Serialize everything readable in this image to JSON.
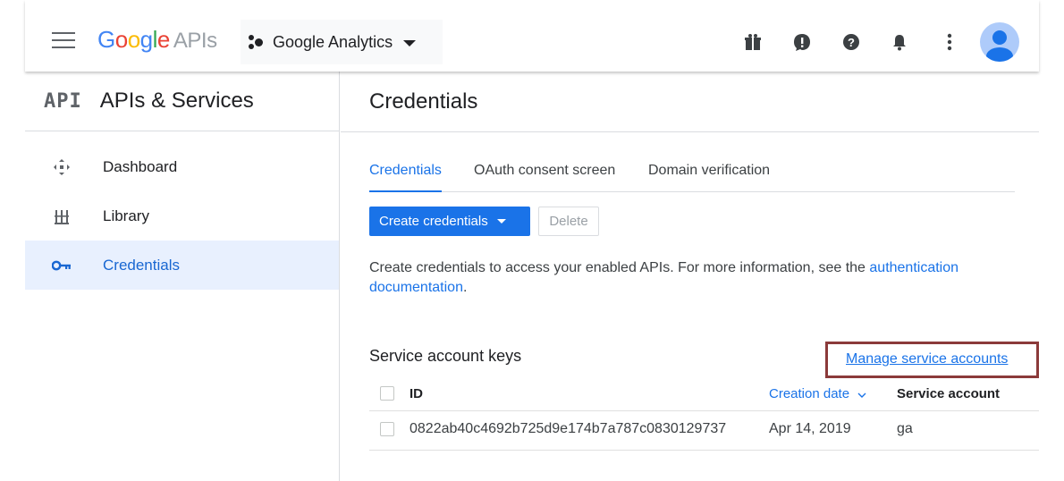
{
  "topbar": {
    "logo_letters": [
      "G",
      "o",
      "o",
      "g",
      "l",
      "e"
    ],
    "logo_suffix": "APIs",
    "project_name": "Google Analytics",
    "icons": [
      "gift-icon",
      "feedback-icon",
      "help-icon",
      "notifications-icon",
      "more-vert-icon",
      "account-avatar"
    ]
  },
  "sidebar": {
    "api_mark": "API",
    "title": "APIs & Services",
    "items": [
      {
        "label": "Dashboard",
        "icon": "dashboard-icon"
      },
      {
        "label": "Library",
        "icon": "library-icon"
      },
      {
        "label": "Credentials",
        "icon": "key-icon",
        "active": true
      }
    ]
  },
  "main": {
    "title": "Credentials",
    "tabs": [
      {
        "label": "Credentials",
        "active": true
      },
      {
        "label": "OAuth consent screen"
      },
      {
        "label": "Domain verification"
      }
    ],
    "create_button": "Create credentials",
    "delete_button": "Delete",
    "info_text": "Create credentials to access your enabled APIs. For more information, see the ",
    "info_link_1": "authentication",
    "info_link_2": "documentation",
    "info_end": ".",
    "section_title": "Service account keys",
    "manage_link": "Manage service accounts",
    "table": {
      "headers": {
        "id": "ID",
        "creation_date": "Creation date",
        "service_account": "Service account"
      },
      "rows": [
        {
          "id": "0822ab40c4692b725d9e174b7a787c0830129737",
          "creation_date": "Apr 14, 2019",
          "service_account": "ga"
        }
      ]
    }
  },
  "colors": {
    "primary": "#1a73e8",
    "active_bg": "#e8f0fe",
    "highlight_box": "#8b3a3a"
  }
}
